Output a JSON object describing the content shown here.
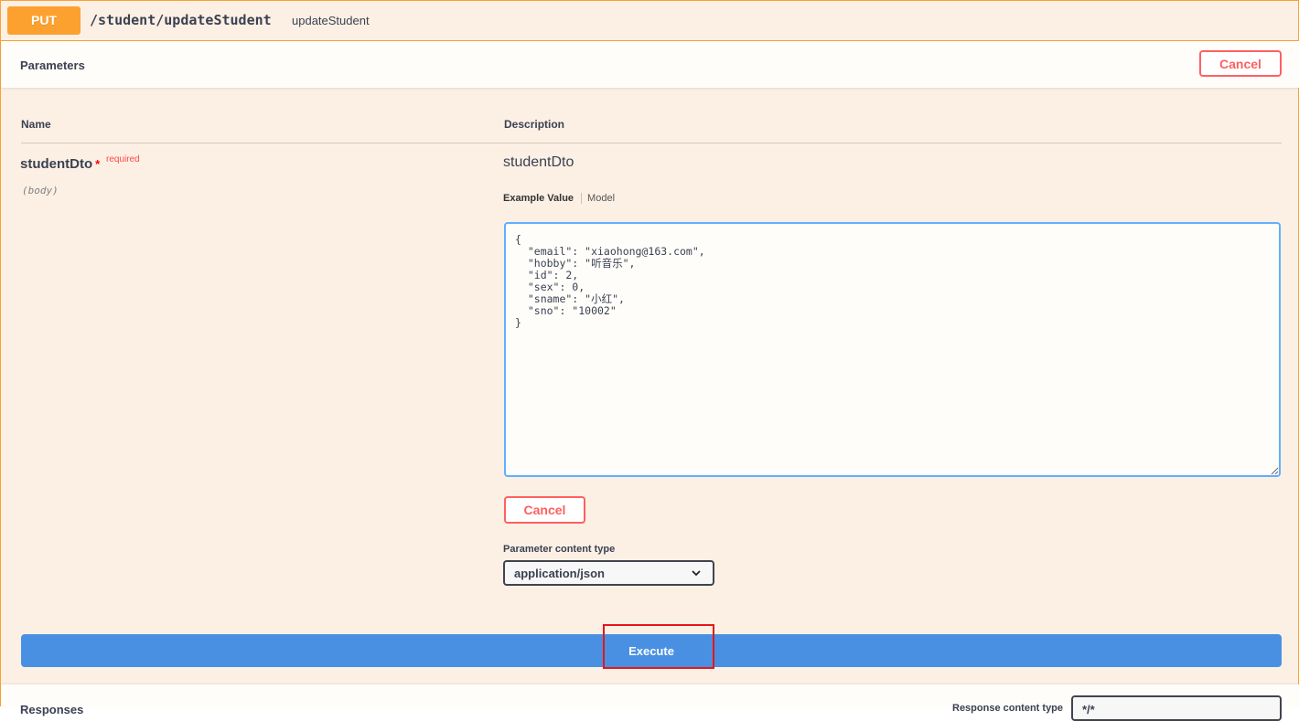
{
  "operation": {
    "method": "PUT",
    "path": "/student/updateStudent",
    "summary": "updateStudent"
  },
  "parameters_section": {
    "title": "Parameters",
    "cancel_label": "Cancel"
  },
  "table": {
    "col_name": "Name",
    "col_description": "Description"
  },
  "param": {
    "name": "studentDto",
    "required_marker": "*",
    "required_label": "required",
    "in": "(body)",
    "description": "studentDto",
    "tab_example": "Example Value",
    "tab_model": "Model",
    "body_value": "{\n  \"email\": \"xiaohong@163.com\",\n  \"hobby\": \"听音乐\",\n  \"id\": 2,\n  \"sex\": 0,\n  \"sname\": \"小红\",\n  \"sno\": \"10002\"\n}",
    "cancel_label": "Cancel",
    "content_type_label": "Parameter content type",
    "content_type_value": "application/json"
  },
  "execute_label": "Execute",
  "responses": {
    "title": "Responses",
    "content_type_label": "Response content type",
    "content_type_value": "*/*"
  },
  "colors": {
    "put": "#fca130",
    "cancel": "#ff6060",
    "execute": "#4990e2",
    "highlight": "#e5161b"
  }
}
